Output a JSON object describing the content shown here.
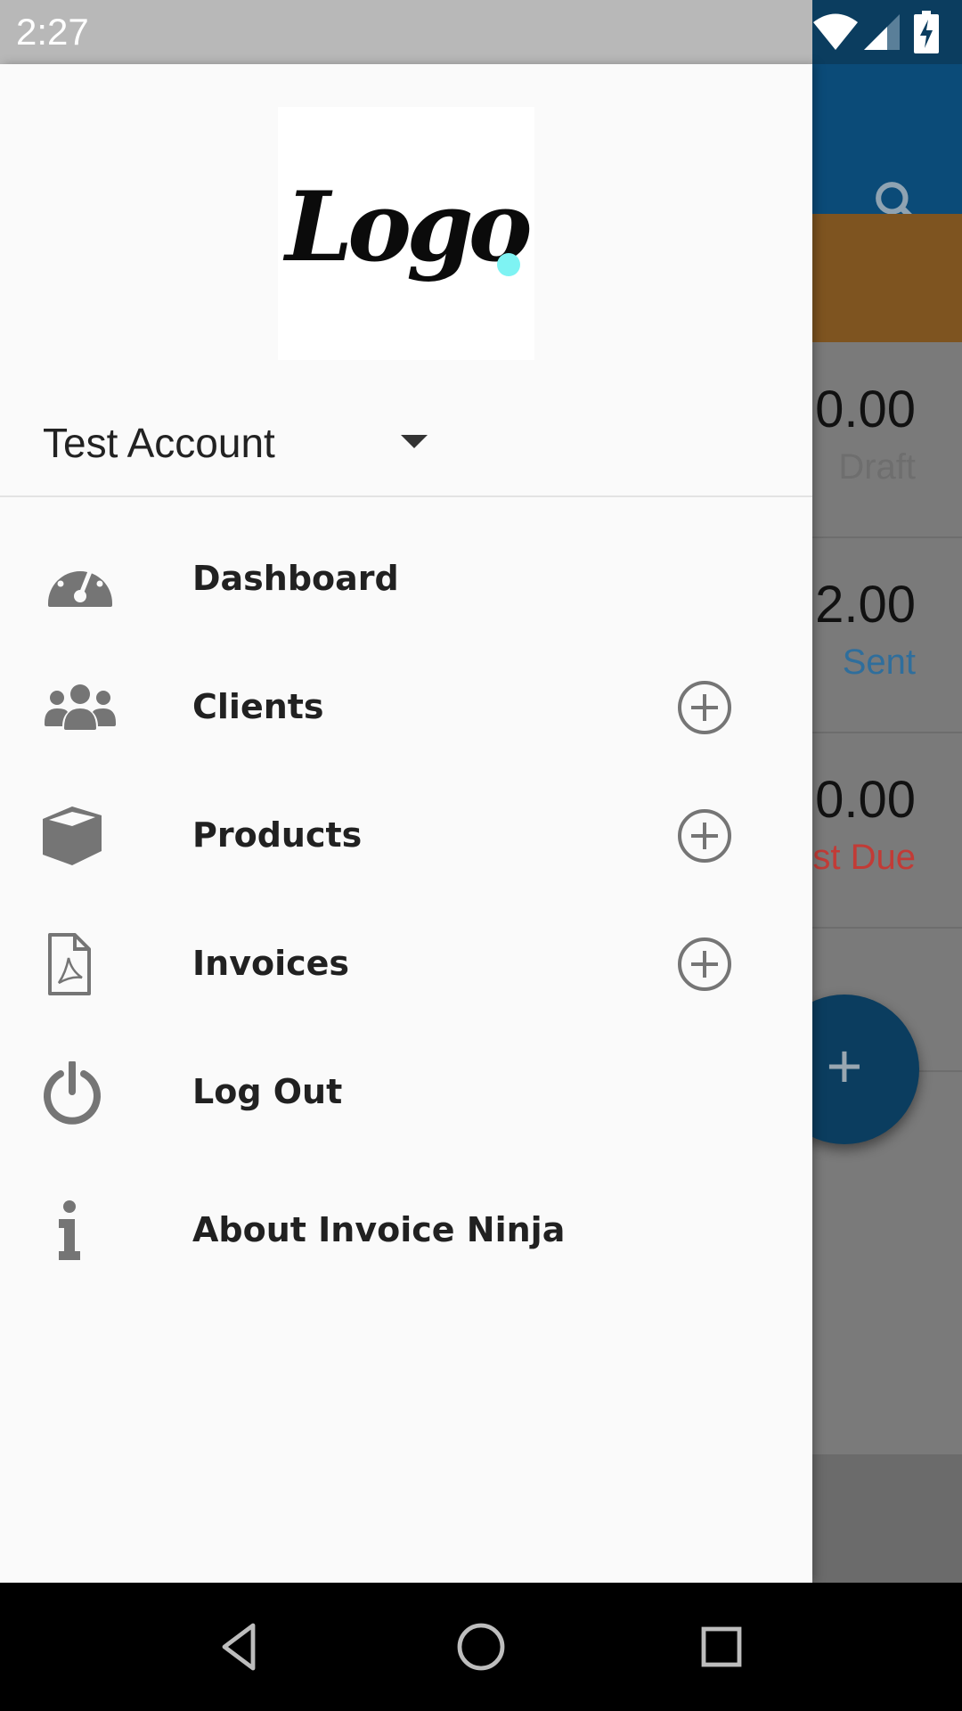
{
  "status_bar": {
    "time": "2:27"
  },
  "background": {
    "rows": [
      {
        "amount": "0.00",
        "status": "Draft",
        "status_color": "#6e6e6e"
      },
      {
        "amount": "2.00",
        "status": "Sent",
        "status_color": "#2f6e9c"
      },
      {
        "amount": "0.00",
        "status": "st Due",
        "status_color": "#c23b36"
      }
    ],
    "fab_label": "+"
  },
  "drawer": {
    "logo_text": "Logo",
    "account": {
      "name": "Test Account"
    },
    "items": [
      {
        "label": "Dashboard",
        "icon": "dashboard-icon",
        "has_add": false
      },
      {
        "label": "Clients",
        "icon": "users-icon",
        "has_add": true
      },
      {
        "label": "Products",
        "icon": "cube-icon",
        "has_add": true
      },
      {
        "label": "Invoices",
        "icon": "pdf-file-icon",
        "has_add": true
      },
      {
        "label": "Log Out",
        "icon": "power-icon",
        "has_add": false
      },
      {
        "label": "About Invoice Ninja",
        "icon": "info-icon",
        "has_add": false
      }
    ]
  },
  "colors": {
    "app_bar": "#0b4b78",
    "banner": "#7e5420",
    "drawer_bg": "#fafafa",
    "icon_gray": "#757575"
  }
}
